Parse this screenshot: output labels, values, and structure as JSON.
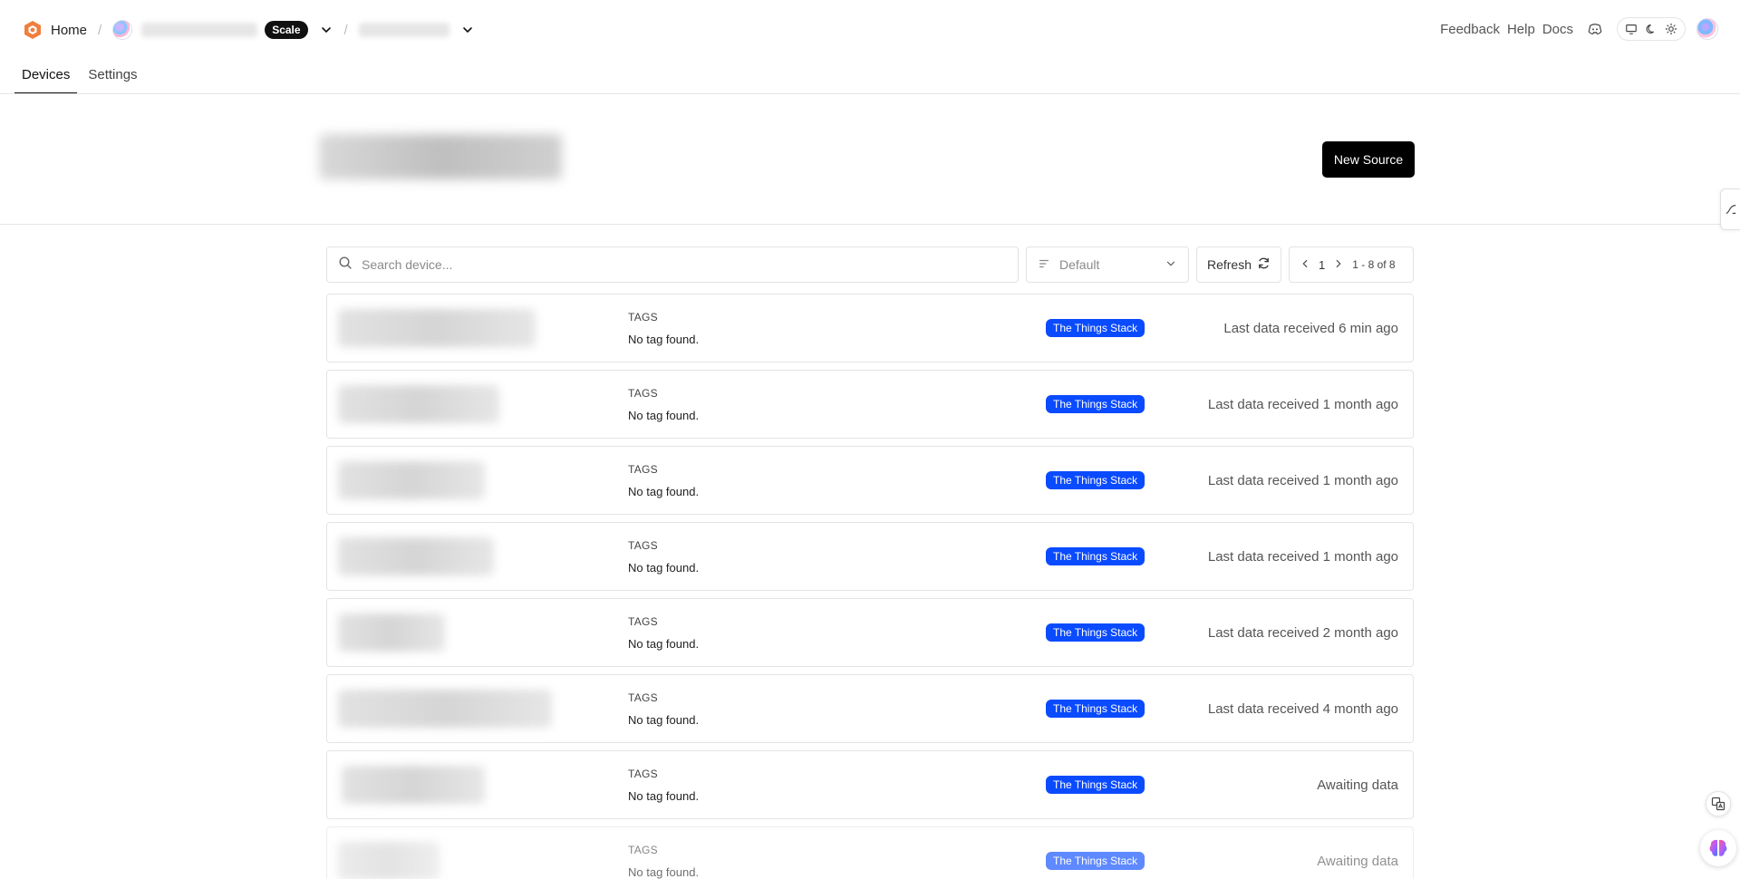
{
  "header": {
    "home_label": "Home",
    "plan_badge": "Scale",
    "links": {
      "feedback": "Feedback",
      "help": "Help",
      "docs": "Docs"
    }
  },
  "tabs": [
    {
      "label": "Devices",
      "active": true
    },
    {
      "label": "Settings",
      "active": false
    }
  ],
  "actions": {
    "new_source_label": "New Source"
  },
  "toolbar": {
    "search_placeholder": "Search device...",
    "sort_value": "Default",
    "refresh_label": "Refresh",
    "page": "1",
    "range": "1 - 8 of 8"
  },
  "devices": [
    {
      "tags_label": "TAGS",
      "tags_value": "No tag found.",
      "source": "The Things Stack",
      "status": "Last data received 6 min ago"
    },
    {
      "tags_label": "TAGS",
      "tags_value": "No tag found.",
      "source": "The Things Stack",
      "status": "Last data received 1 month ago"
    },
    {
      "tags_label": "TAGS",
      "tags_value": "No tag found.",
      "source": "The Things Stack",
      "status": "Last data received 1 month ago"
    },
    {
      "tags_label": "TAGS",
      "tags_value": "No tag found.",
      "source": "The Things Stack",
      "status": "Last data received 1 month ago"
    },
    {
      "tags_label": "TAGS",
      "tags_value": "No tag found.",
      "source": "The Things Stack",
      "status": "Last data received 2 month ago"
    },
    {
      "tags_label": "TAGS",
      "tags_value": "No tag found.",
      "source": "The Things Stack",
      "status": "Last data received 4 month ago"
    },
    {
      "tags_label": "TAGS",
      "tags_value": "No tag found.",
      "source": "The Things Stack",
      "status": "Awaiting data"
    },
    {
      "tags_label": "TAGS",
      "tags_value": "No tag found.",
      "source": "The Things Stack",
      "status": "Awaiting data"
    }
  ],
  "icons": {
    "logo": "hexagon-logo-icon",
    "discord": "discord-icon",
    "theme_system": "monitor-icon",
    "theme_dark": "moon-icon",
    "theme_light": "sun-icon",
    "search": "search-icon",
    "sort": "sort-lines-icon",
    "refresh": "refresh-icon",
    "prev": "chevron-left-icon",
    "next": "chevron-right-icon",
    "translate": "translate-icon",
    "assistant": "brain-icon"
  },
  "colors": {
    "accent_logo": "#f07e3d",
    "source_badge": "#0a4bff",
    "primary_button": "#000000",
    "plan_badge": "#111111"
  }
}
